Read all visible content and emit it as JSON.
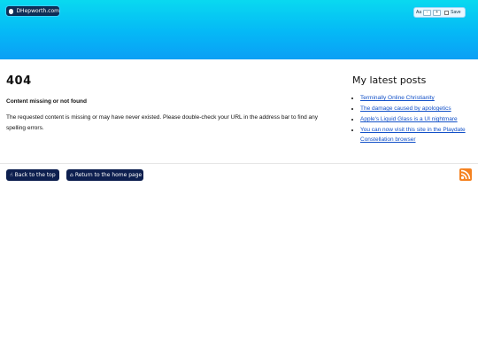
{
  "header": {
    "site_name": "DHepworth.com",
    "controls": {
      "font_label": "Aa",
      "decrease_label": "-",
      "increase_label": "+",
      "save_label": "Save"
    }
  },
  "main": {
    "title": "404",
    "subheading": "Content missing or not found",
    "body": "The requested content is missing or may have never existed. Please double-check your URL in the address bar to find any spelling errors."
  },
  "sidebar": {
    "title": "My latest posts",
    "posts": [
      {
        "label": "Terminally Online Christianity"
      },
      {
        "label": "The damage caused by apologetics"
      },
      {
        "label": "Apple's Liquid Glass is a UI nightmare"
      },
      {
        "label": "You can now visit this site in the Playdate Constellation browser"
      }
    ]
  },
  "footer": {
    "back_to_top": {
      "icon": "pointing-up-hand-icon",
      "label": "Back to the top"
    },
    "home": {
      "icon": "home-icon",
      "label": "Return to the home page"
    },
    "rss_icon": "rss-icon"
  },
  "colors": {
    "header_gradient_start": "#09d9f0",
    "header_gradient_end": "#0b9ff5",
    "button_background": "#0d1f4f",
    "link": "#1250c8",
    "rss": "#f58220"
  }
}
